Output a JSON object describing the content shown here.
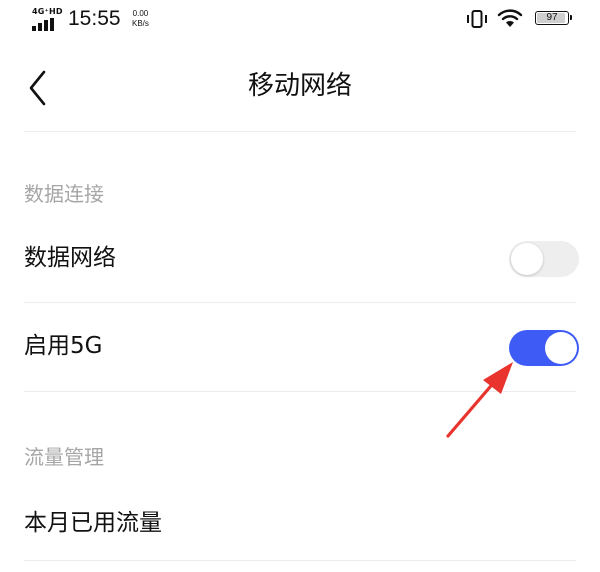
{
  "status_bar": {
    "network_type": "4G⁺HD",
    "time": "15:55",
    "speed_value": "0.00",
    "speed_unit": "KB/s",
    "battery_level": "97",
    "battery_fraction": 0.97,
    "icons": [
      "signal-icon",
      "vibrate-icon",
      "wifi-icon",
      "battery-icon"
    ]
  },
  "header": {
    "back_icon": "chevron-left-icon",
    "title": "移动网络"
  },
  "sections": [
    {
      "header": "数据连接",
      "rows": [
        {
          "label": "数据网络",
          "toggle": false
        },
        {
          "label": "启用5G",
          "toggle": true
        }
      ]
    },
    {
      "header": "流量管理",
      "rows": [
        {
          "label": "本月已用流量"
        }
      ]
    }
  ],
  "colors": {
    "accent": "#3e5cf5",
    "toggle_off": "#eeeeee",
    "annotation_arrow": "#e8342d",
    "section_header_text": "#a6a6a6"
  }
}
